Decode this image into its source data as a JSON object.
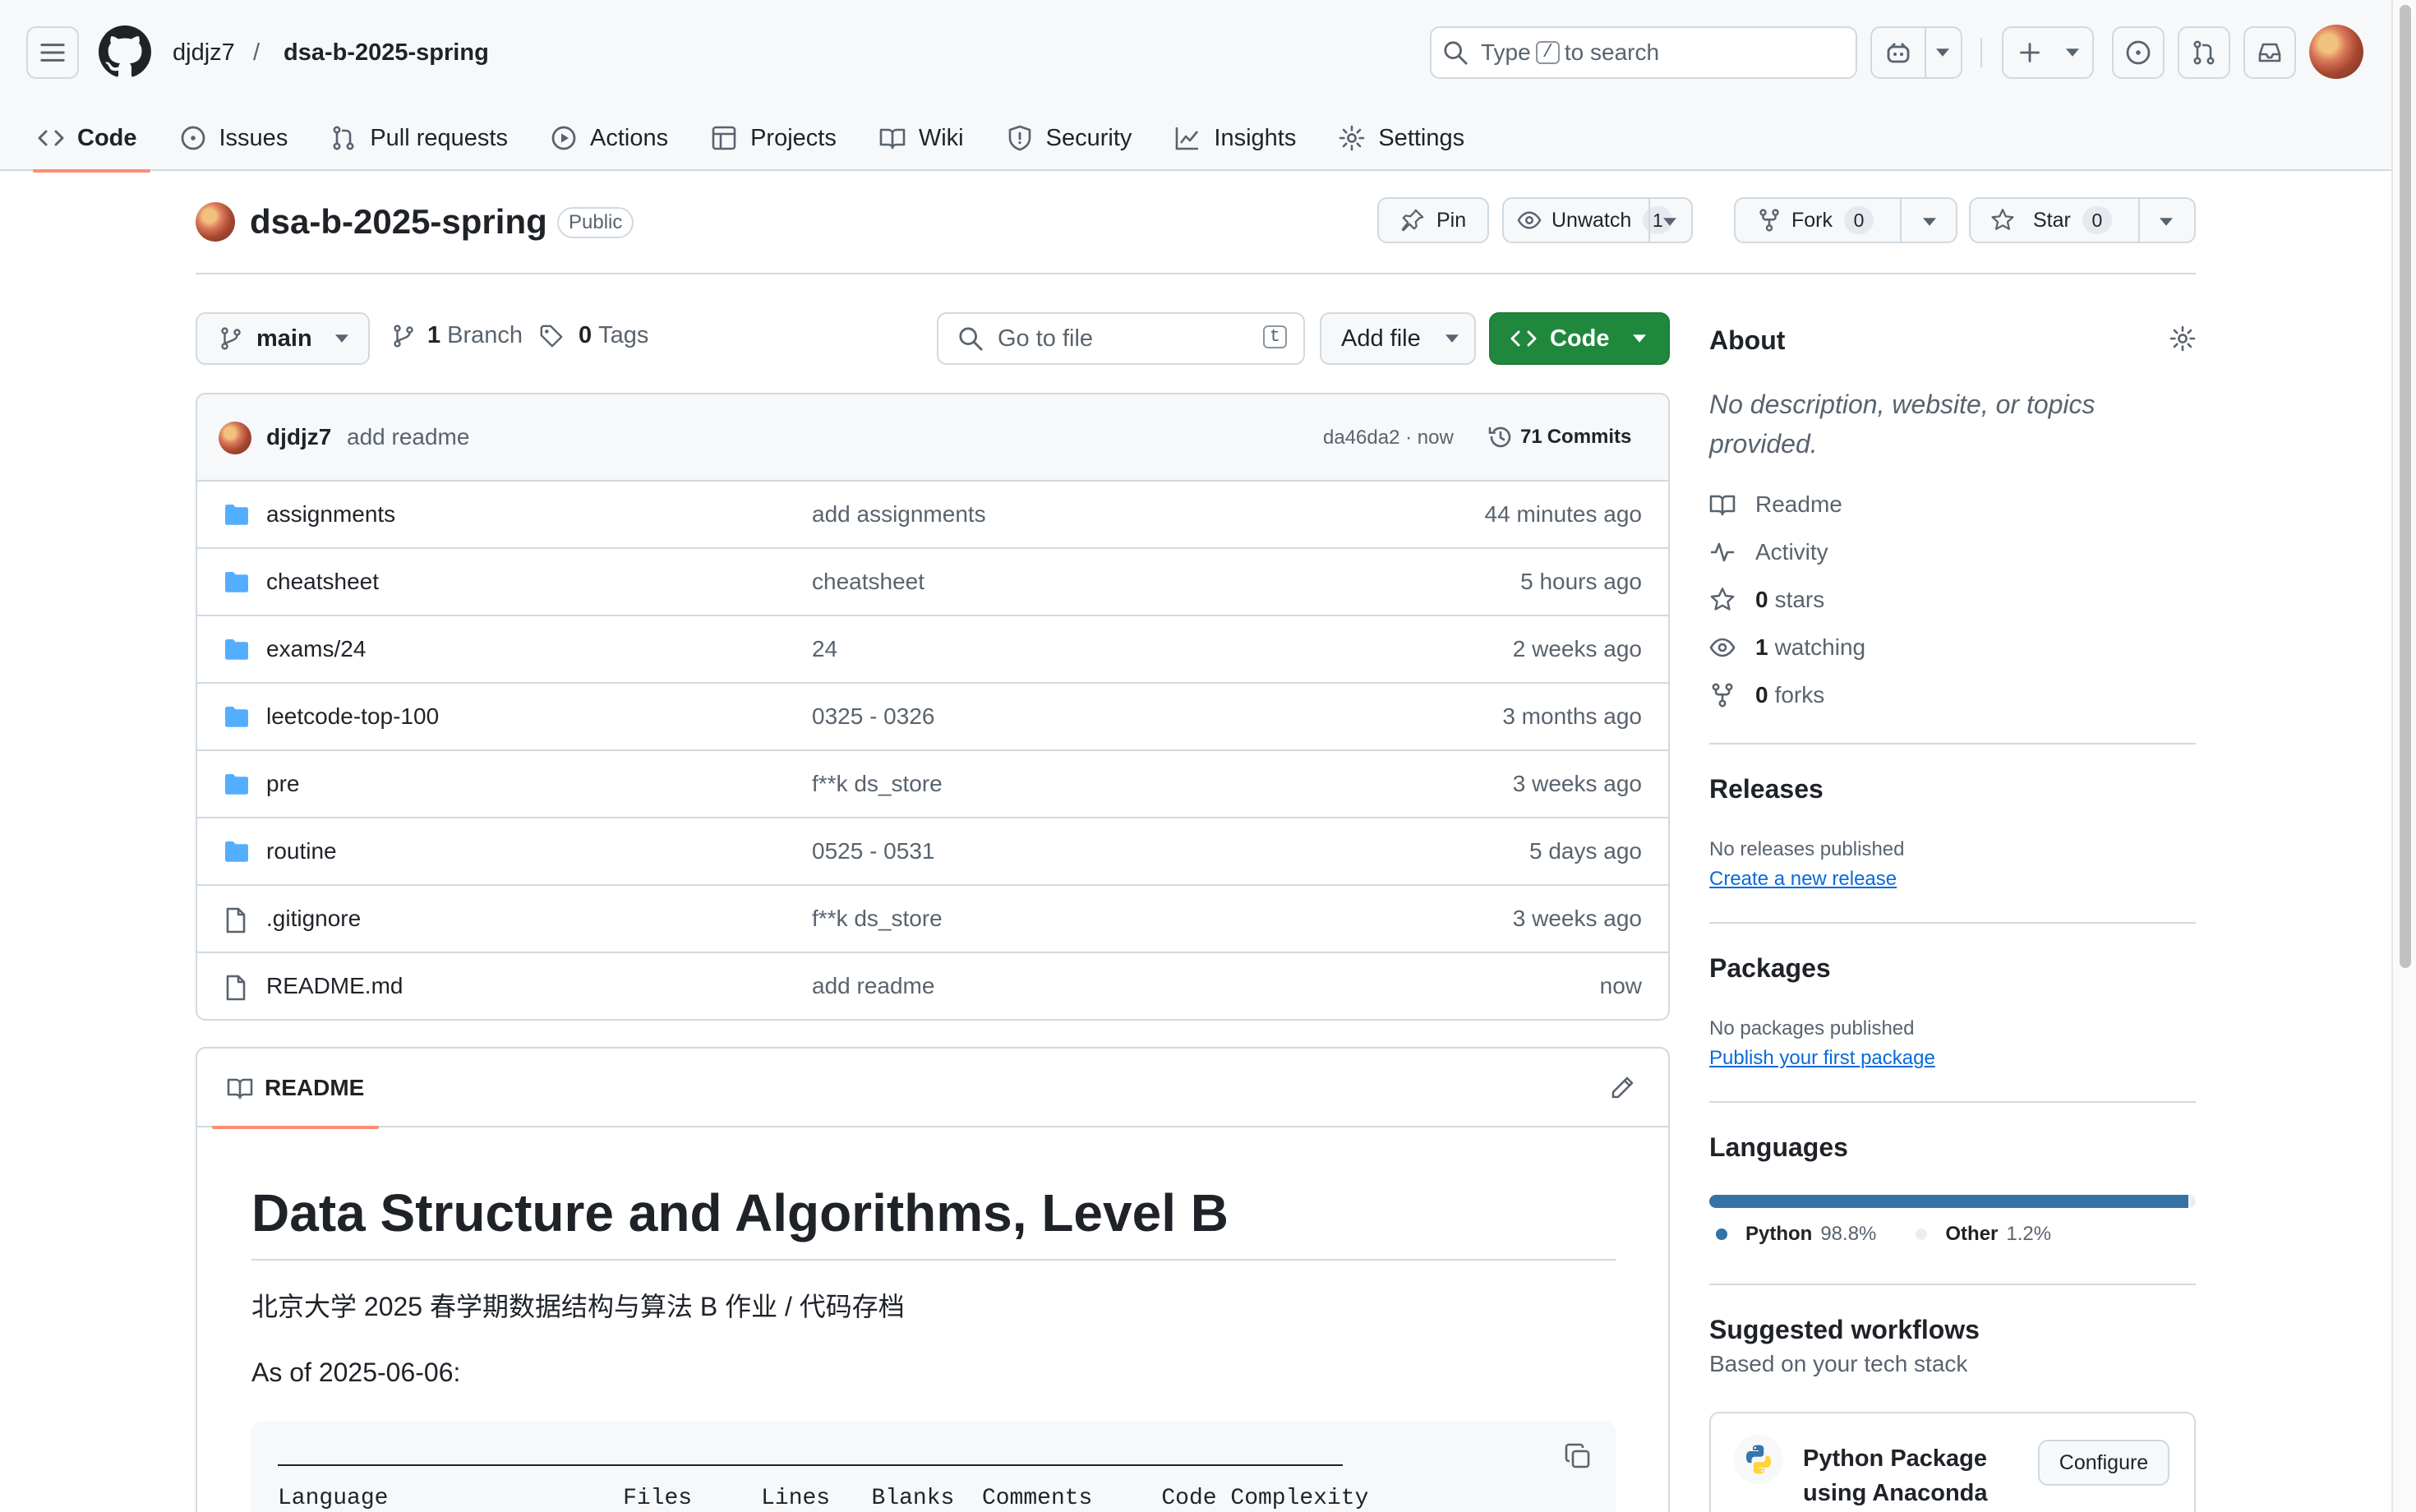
{
  "header": {
    "owner": "djdjz7",
    "separator": "/",
    "repo": "dsa-b-2025-spring",
    "search_prefix": "Type",
    "search_key": "/",
    "search_suffix": "to search",
    "icons": [
      "hamburger-icon",
      "github-logo-icon",
      "search-icon",
      "copilot-icon",
      "plus-icon",
      "issue-icon",
      "pull-request-icon",
      "inbox-icon"
    ]
  },
  "nav": {
    "tabs": [
      {
        "label": "Code",
        "icon": "code-icon",
        "active": true
      },
      {
        "label": "Issues",
        "icon": "issue-icon"
      },
      {
        "label": "Pull requests",
        "icon": "pull-request-icon"
      },
      {
        "label": "Actions",
        "icon": "play-icon"
      },
      {
        "label": "Projects",
        "icon": "table-icon"
      },
      {
        "label": "Wiki",
        "icon": "book-icon"
      },
      {
        "label": "Security",
        "icon": "shield-icon"
      },
      {
        "label": "Insights",
        "icon": "graph-icon"
      },
      {
        "label": "Settings",
        "icon": "gear-icon"
      }
    ]
  },
  "repo": {
    "name": "dsa-b-2025-spring",
    "visibility": "Public",
    "pin_label": "Pin",
    "unwatch_label": "Unwatch",
    "watch_count": "1",
    "fork_label": "Fork",
    "fork_count": "0",
    "star_label": "Star",
    "star_count": "0"
  },
  "toolbar": {
    "branch": "main",
    "branch_count": "1",
    "branch_label": "Branch",
    "tag_count": "0",
    "tag_label": "Tags",
    "goto_placeholder": "Go to file",
    "goto_key": "t",
    "add_file_label": "Add file",
    "code_label": "Code"
  },
  "latest_commit": {
    "author": "djdjz7",
    "message": "add readme",
    "hash": "da46da2",
    "time": "now",
    "commit_count": "71",
    "commit_label": "Commits"
  },
  "files": [
    {
      "name": "assignments",
      "type": "folder",
      "message": "add assignments",
      "time": "44 minutes ago"
    },
    {
      "name": "cheatsheet",
      "type": "folder",
      "message": "cheatsheet",
      "time": "5 hours ago"
    },
    {
      "name": "exams/24",
      "type": "folder",
      "message": "24",
      "time": "2 weeks ago"
    },
    {
      "name": "leetcode-top-100",
      "type": "folder",
      "message": "0325 - 0326",
      "time": "3 months ago"
    },
    {
      "name": "pre",
      "type": "folder",
      "message": "f**k ds_store",
      "time": "3 weeks ago"
    },
    {
      "name": "routine",
      "type": "folder",
      "message": "0525 - 0531",
      "time": "5 days ago"
    },
    {
      "name": ".gitignore",
      "type": "file",
      "message": "f**k ds_store",
      "time": "3 weeks ago"
    },
    {
      "name": "README.md",
      "type": "file",
      "message": "add readme",
      "time": "now"
    }
  ],
  "readme": {
    "tab_label": "README",
    "title": "Data Structure and Algorithms, Level B",
    "subtitle": "北京大学 2025 春学期数据结构与算法 B 作业 / 代码存档",
    "as_of": "As of 2025-06-06:",
    "code_header": "Language                 Files     Lines   Blanks  Comments     Code Complexity"
  },
  "about": {
    "heading": "About",
    "description": "No description, website, or topics provided.",
    "readme_label": "Readme",
    "activity_label": "Activity",
    "stars_count": "0",
    "stars_label": "stars",
    "watching_count": "1",
    "watching_label": "watching",
    "forks_count": "0",
    "forks_label": "forks"
  },
  "releases": {
    "heading": "Releases",
    "empty": "No releases published",
    "link": "Create a new release"
  },
  "packages": {
    "heading": "Packages",
    "empty": "No packages published",
    "link": "Publish your first package"
  },
  "languages": {
    "heading": "Languages",
    "items": [
      {
        "name": "Python",
        "percent": "98.8%",
        "value": 98.8,
        "color": "#3572A5"
      },
      {
        "name": "Other",
        "percent": "1.2%",
        "value": 1.2,
        "color": "#ededed"
      }
    ]
  },
  "workflows": {
    "heading": "Suggested workflows",
    "subheading": "Based on your tech stack",
    "item_title_1": "Python Package",
    "item_title_2": "using Anaconda",
    "configure_label": "Configure"
  },
  "colors": {
    "accent_underline": "#fd8c73",
    "code_button": "#1f883d",
    "link": "#0969da",
    "folder": "#54aeff"
  }
}
